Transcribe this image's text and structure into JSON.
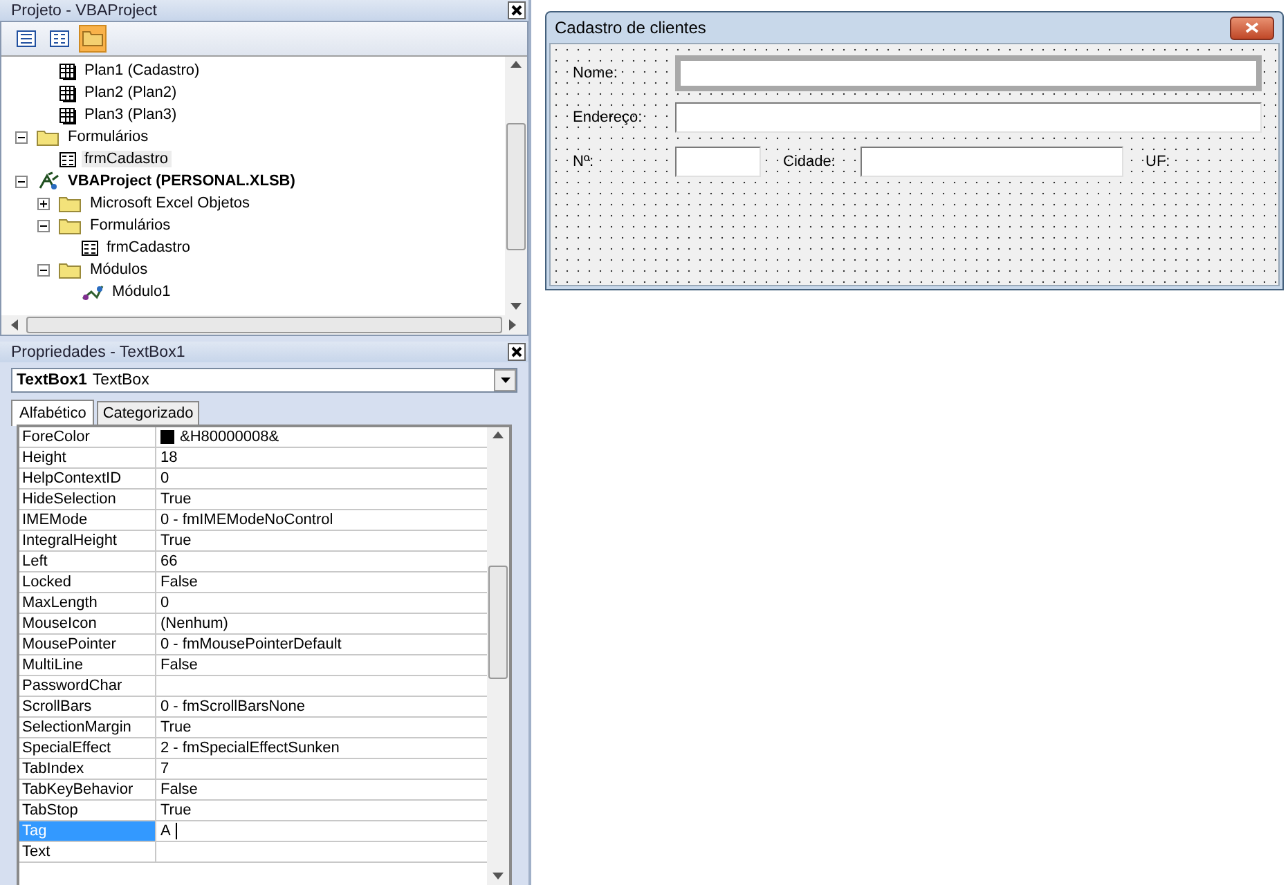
{
  "project_window": {
    "title": "Projeto - VBAProject",
    "tree": [
      {
        "children": [
          {
            "children": [
              {
                "kind": "sheet",
                "label": "Plan1 (Cadastro)",
                "selected": false
              },
              {
                "kind": "sheet",
                "label": "Plan2 (Plan2)",
                "selected": false
              },
              {
                "kind": "sheet",
                "label": "Plan3 (Plan3)",
                "selected": false
              }
            ]
          },
          {
            "kind": "folder",
            "label": "Formulários",
            "expanded": true,
            "selected": false,
            "children": [
              {
                "kind": "form",
                "label": "frmCadastro",
                "selected": true
              }
            ]
          }
        ]
      },
      {
        "kind": "project",
        "label": "VBAProject (PERSONAL.XLSB)",
        "expanded": true,
        "selected": false,
        "children": [
          {
            "kind": "folder",
            "label": "Microsoft Excel Objetos",
            "expanded": false,
            "selected": false
          },
          {
            "kind": "folder",
            "label": "Formulários",
            "expanded": true,
            "selected": false,
            "children": [
              {
                "kind": "form",
                "label": "frmCadastro",
                "selected": false
              }
            ]
          },
          {
            "kind": "folder",
            "label": "Módulos",
            "expanded": true,
            "selected": false,
            "children": [
              {
                "kind": "module",
                "label": "Módulo1",
                "selected": false
              }
            ]
          }
        ]
      }
    ]
  },
  "properties_window": {
    "title": "Propriedades - TextBox1",
    "object": {
      "name": "TextBox1",
      "type": "TextBox"
    },
    "tabs": [
      {
        "label": "Alfabético",
        "selected": true
      },
      {
        "label": "Categorizado",
        "selected": false
      }
    ],
    "rows": [
      {
        "name": "ForeColor",
        "value": "&H80000008&",
        "color": "#000000",
        "selected": false
      },
      {
        "name": "Height",
        "value": "18",
        "selected": false
      },
      {
        "name": "HelpContextID",
        "value": "0",
        "selected": false
      },
      {
        "name": "HideSelection",
        "value": "True",
        "selected": false
      },
      {
        "name": "IMEMode",
        "value": "0 - fmIMEModeNoControl",
        "selected": false
      },
      {
        "name": "IntegralHeight",
        "value": "True",
        "selected": false
      },
      {
        "name": "Left",
        "value": "66",
        "selected": false
      },
      {
        "name": "Locked",
        "value": "False",
        "selected": false
      },
      {
        "name": "MaxLength",
        "value": "0",
        "selected": false
      },
      {
        "name": "MouseIcon",
        "value": "(Nenhum)",
        "selected": false
      },
      {
        "name": "MousePointer",
        "value": "0 - fmMousePointerDefault",
        "selected": false
      },
      {
        "name": "MultiLine",
        "value": "False",
        "selected": false
      },
      {
        "name": "PasswordChar",
        "selected": false
      },
      {
        "name": "ScrollBars",
        "value": "0 - fmScrollBarsNone",
        "selected": false
      },
      {
        "name": "SelectionMargin",
        "value": "True",
        "selected": false
      },
      {
        "name": "SpecialEffect",
        "value": "2 - fmSpecialEffectSunken",
        "selected": false
      },
      {
        "name": "TabIndex",
        "value": "7",
        "selected": false
      },
      {
        "name": "TabKeyBehavior",
        "value": "False",
        "selected": false
      },
      {
        "name": "TabStop",
        "value": "True",
        "selected": false
      },
      {
        "name": "Tag",
        "value": "A",
        "selected": true
      },
      {
        "name": "Text",
        "selected": false
      }
    ]
  },
  "form_designer": {
    "title": "Cadastro de clientes",
    "rows": [
      [
        {
          "kind": "label",
          "text": "Nome:"
        },
        {
          "kind": "textbox",
          "selected": true
        }
      ],
      [
        {
          "kind": "label",
          "text": "Endereço:"
        },
        {
          "kind": "textbox",
          "selected": false
        }
      ],
      [
        {
          "kind": "label",
          "text": "Nº:"
        },
        {
          "kind": "textbox",
          "selected": false
        },
        {
          "kind": "label",
          "text": "Cidade:"
        },
        {
          "kind": "textbox",
          "selected": false
        },
        {
          "kind": "label",
          "text": "UF:"
        }
      ]
    ]
  }
}
